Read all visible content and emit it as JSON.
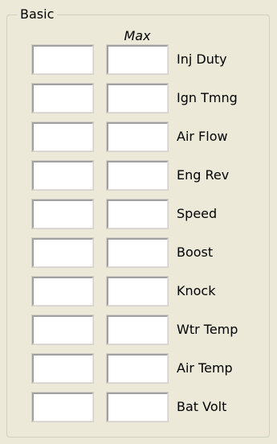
{
  "group": {
    "title": "Basic"
  },
  "columns": {
    "max_header": "Max"
  },
  "rows": [
    {
      "label": "Inj Duty",
      "current": "",
      "max": ""
    },
    {
      "label": "Ign Tmng",
      "current": "",
      "max": ""
    },
    {
      "label": "Air Flow",
      "current": "",
      "max": ""
    },
    {
      "label": "Eng Rev",
      "current": "",
      "max": ""
    },
    {
      "label": "Speed",
      "current": "",
      "max": ""
    },
    {
      "label": "Boost",
      "current": "",
      "max": ""
    },
    {
      "label": "Knock",
      "current": "",
      "max": ""
    },
    {
      "label": "Wtr Temp",
      "current": "",
      "max": ""
    },
    {
      "label": "Air Temp",
      "current": "",
      "max": ""
    },
    {
      "label": "Bat Volt",
      "current": "",
      "max": ""
    }
  ]
}
